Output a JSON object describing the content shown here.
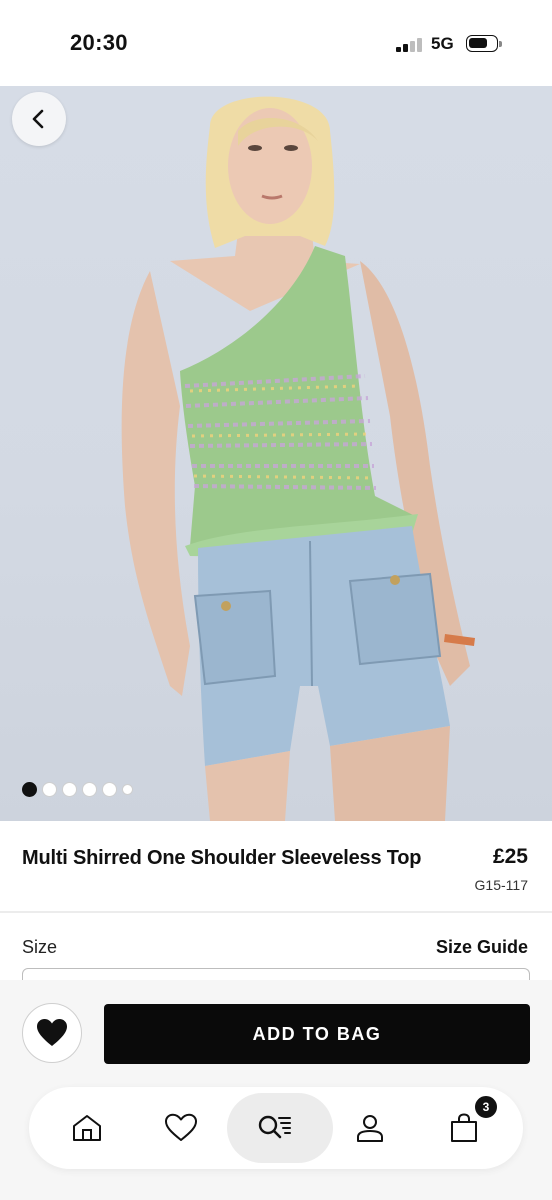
{
  "status_bar": {
    "time": "20:30",
    "network": "5G",
    "battery_level": 0.7
  },
  "gallery": {
    "image_count": 6,
    "active_index": 0
  },
  "product": {
    "title": "Multi Shirred One Shoulder Sleeveless Top",
    "price": "£25",
    "sku": "G15-117"
  },
  "size": {
    "label": "Size",
    "guide_label": "Size Guide"
  },
  "actions": {
    "add_to_bag_label": "ADD TO BAG"
  },
  "bottom_nav": {
    "items": [
      {
        "icon": "home-icon"
      },
      {
        "icon": "heart-icon"
      },
      {
        "icon": "search-list-icon",
        "active": true
      },
      {
        "icon": "account-icon"
      },
      {
        "icon": "bag-icon"
      }
    ],
    "bag_count": "3"
  },
  "colors": {
    "accent": "#0a0a0a",
    "background": "#ffffff",
    "panel": "#f6f6f6"
  }
}
